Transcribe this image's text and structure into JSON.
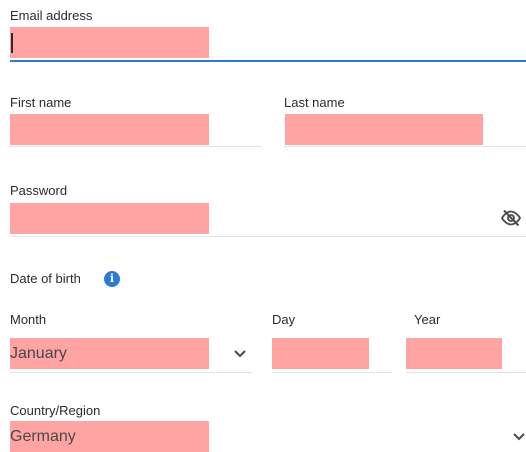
{
  "form": {
    "email": {
      "label": "Email address",
      "value": ""
    },
    "first_name": {
      "label": "First name",
      "value": ""
    },
    "last_name": {
      "label": "Last name",
      "value": ""
    },
    "password": {
      "label": "Password",
      "value": "",
      "toggle_icon": "eye-slash-icon"
    },
    "dob": {
      "label": "Date of birth",
      "info_icon": "info-icon",
      "info_glyph": "i",
      "month": {
        "label": "Month",
        "value": "January"
      },
      "day": {
        "label": "Day",
        "value": ""
      },
      "year": {
        "label": "Year",
        "value": ""
      }
    },
    "country": {
      "label": "Country/Region",
      "value": "Germany"
    }
  },
  "colors": {
    "focus_underline": "#2d7ad6",
    "underline": "#e4e4e4",
    "redaction": "#ffa3a3",
    "info_icon": "#2d7ad6"
  }
}
